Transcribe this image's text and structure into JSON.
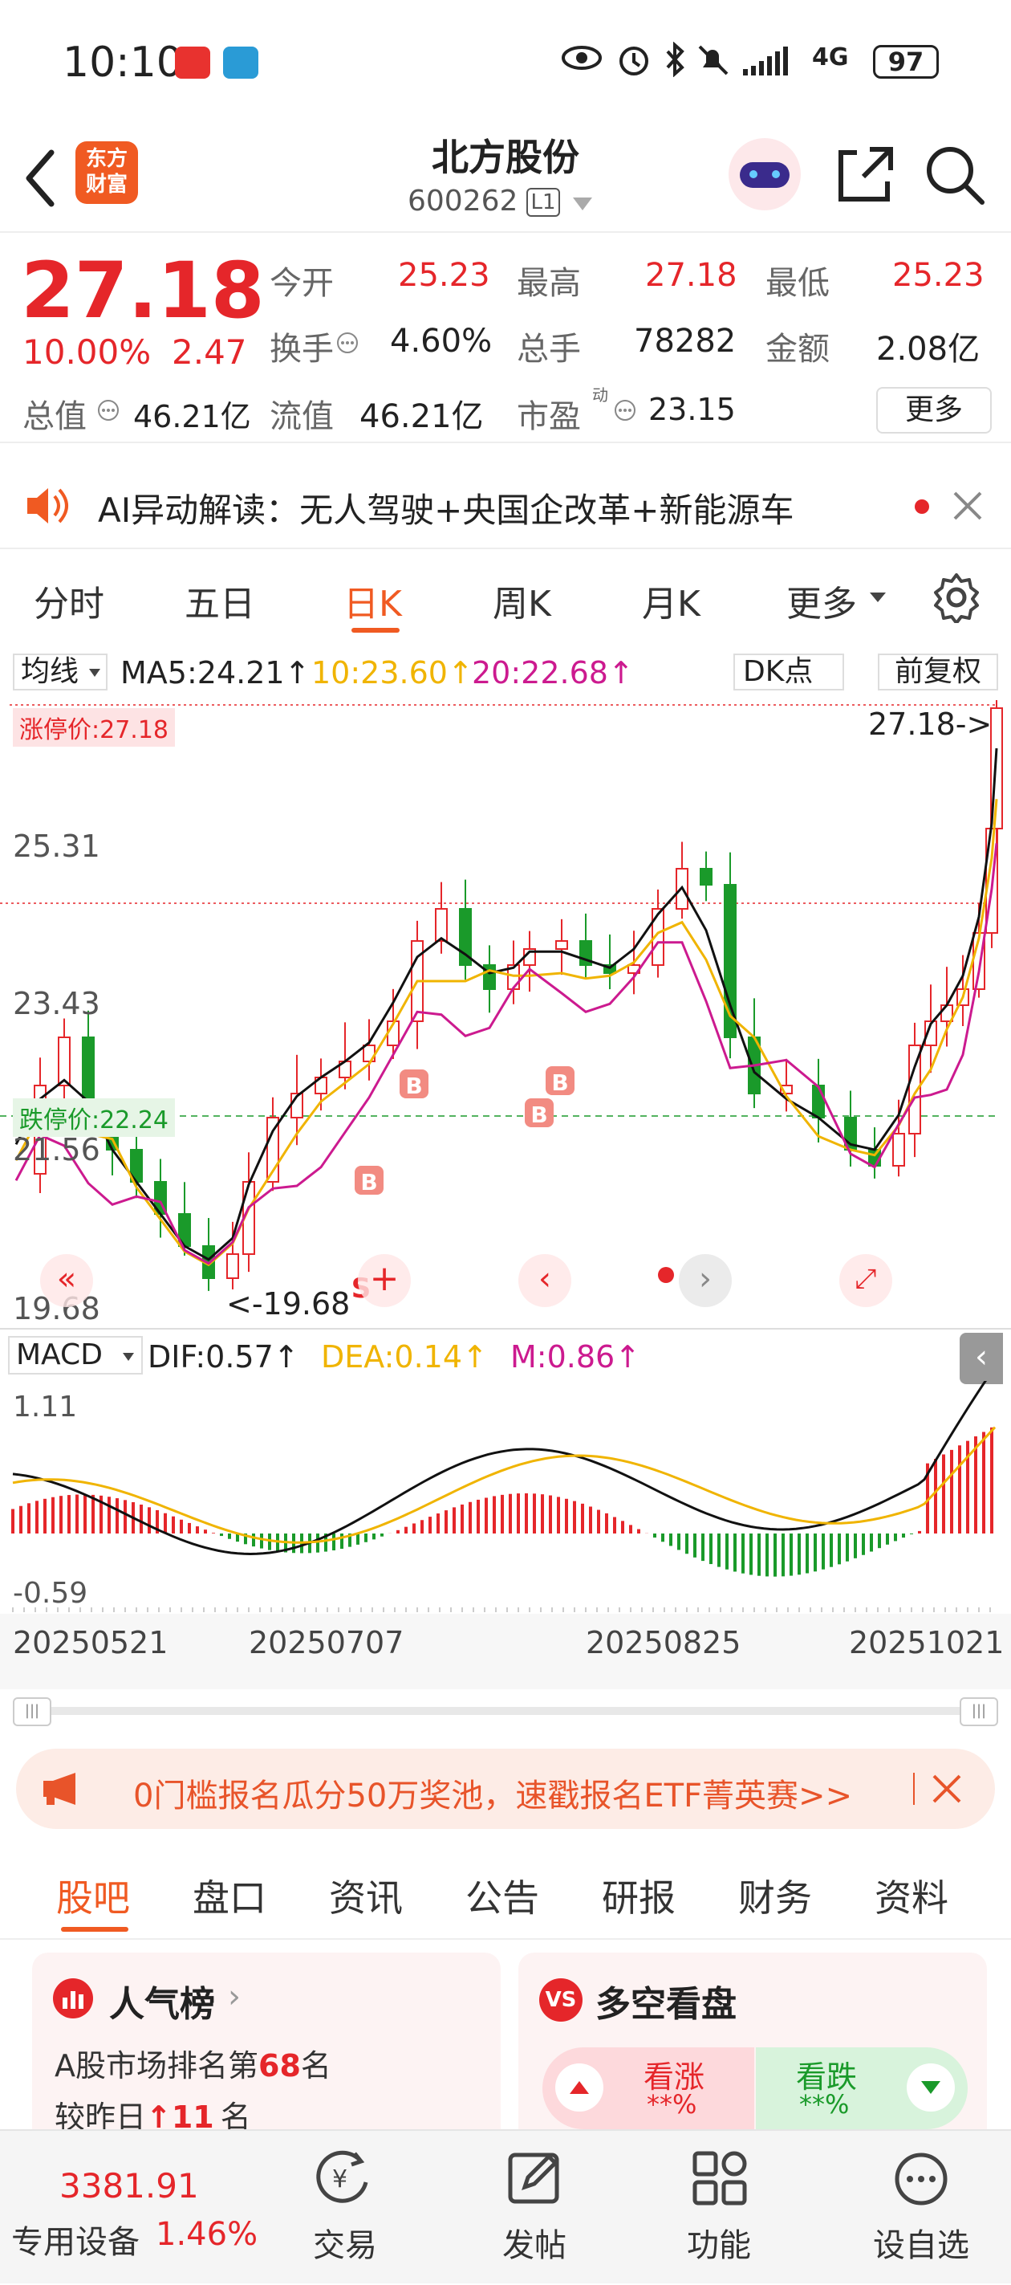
{
  "status_bar": {
    "time": "10:10",
    "network": "4G",
    "battery": "97"
  },
  "header": {
    "logo_text_1": "东方",
    "logo_text_2": "财富",
    "stock_name": "北方股份",
    "stock_code": "600262",
    "level_badge": "L1"
  },
  "quote": {
    "price": "27.18",
    "change_pct": "10.00%",
    "change_amt": "2.47",
    "open_label": "今开",
    "open_value": "25.23",
    "high_label": "最高",
    "high_value": "27.18",
    "low_label": "最低",
    "low_value": "25.23",
    "turnover_label": "换手",
    "turnover_value": "4.60%",
    "volume_label": "总手",
    "volume_value": "78282",
    "amount_label": "金额",
    "amount_value": "2.08亿",
    "mktcap_label": "总值",
    "mktcap_value": "46.21亿",
    "float_label": "流值",
    "float_value": "46.21亿",
    "pe_label": "市盈",
    "pe_sup": "动",
    "pe_value": "23.15",
    "more_button": "更多"
  },
  "ai_banner": {
    "text": "AI异动解读：无人驾驶+央国企改革+新能源车"
  },
  "chart_tabs": {
    "items": [
      "分时",
      "五日",
      "日K",
      "周K",
      "月K",
      "更多"
    ],
    "active_index": 2
  },
  "ma_bar": {
    "selector": "均线",
    "ma5": "MA5:24.21",
    "ma10": "10:23.60",
    "ma20": "20:22.68",
    "dk_label": "DK点",
    "adjust_label": "前复权"
  },
  "kline": {
    "limit_up_label": "涨停价:27.18",
    "limit_down_label": "跌停价:22.24",
    "price_marker": "27.18->",
    "low_marker": "<-19.68",
    "axis_labels": [
      "25.31",
      "23.43",
      "21.56",
      "19.68"
    ],
    "ma_colors": {
      "ma5": "#111111",
      "ma10": "#f0b400",
      "ma20": "#cc1a8f"
    },
    "up_color": "#e5262a",
    "down_color": "#1a9a2a",
    "trade_signals": [
      "B",
      "B",
      "B",
      "B",
      "S"
    ]
  },
  "macd_bar": {
    "selector": "MACD",
    "dif": "DIF:0.57",
    "dea": "DEA:0.14",
    "m": "M:0.86",
    "top_label": "1.11",
    "bottom_label": "-0.59"
  },
  "x_axis": {
    "dates": [
      "20250521",
      "20250707",
      "20250825",
      "20251021"
    ]
  },
  "promo": {
    "text": "0门槛报名瓜分50万奖池，速戳报名ETF菁英赛>>"
  },
  "info_tabs": {
    "items": [
      "股吧",
      "盘口",
      "资讯",
      "公告",
      "研报",
      "财务",
      "资料"
    ],
    "active_index": 0
  },
  "popularity": {
    "title": "人气榜",
    "rank_prefix": "A股市场排名第",
    "rank_value": "68",
    "rank_suffix": "名",
    "change_prefix": "较昨日",
    "change_value": "11",
    "change_suffix": "名"
  },
  "bull_bear": {
    "title": "多空看盘",
    "bull_label": "看涨",
    "bull_value": "**%",
    "bear_label": "看跌",
    "bear_value": "**%"
  },
  "bottom_bar": {
    "index_value": "3381.91",
    "sector_name": "专用设备",
    "sector_change": "1.46%",
    "items": [
      "交易",
      "发帖",
      "功能",
      "设自选"
    ]
  }
}
